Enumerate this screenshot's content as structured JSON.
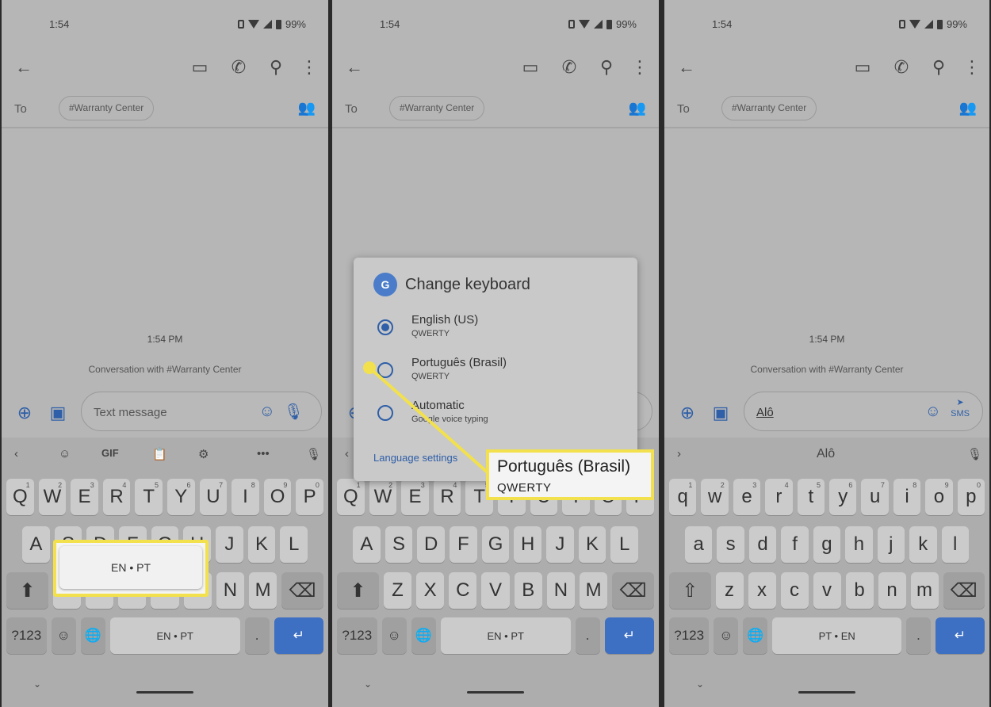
{
  "status": {
    "time": "1:54",
    "battery": "99%"
  },
  "toolbar": {
    "to_label": "To",
    "recipient": "#Warranty Center"
  },
  "conversation": {
    "time": "1:54 PM",
    "with_text": "Conversation with #Warranty Center"
  },
  "compose": {
    "placeholder": "Text message",
    "typed_text": "Alô",
    "send_label": "SMS"
  },
  "keyboard_tools": {
    "gif": "GIF",
    "more": "•••",
    "suggestion": "Alô"
  },
  "keys": {
    "row1_upper": [
      "Q",
      "W",
      "E",
      "R",
      "T",
      "Y",
      "U",
      "I",
      "O",
      "P"
    ],
    "row1_lower": [
      "q",
      "w",
      "e",
      "r",
      "t",
      "y",
      "u",
      "i",
      "o",
      "p"
    ],
    "row1_hints": [
      "1",
      "2",
      "3",
      "4",
      "5",
      "6",
      "7",
      "8",
      "9",
      "0"
    ],
    "row2_upper": [
      "A",
      "S",
      "D",
      "F",
      "G",
      "H",
      "J",
      "K",
      "L"
    ],
    "row2_lower": [
      "a",
      "s",
      "d",
      "f",
      "g",
      "h",
      "j",
      "k",
      "l"
    ],
    "row3_upper": [
      "Z",
      "X",
      "C",
      "V",
      "B",
      "N",
      "M"
    ],
    "row3_lower": [
      "z",
      "x",
      "c",
      "v",
      "b",
      "n",
      "m"
    ],
    "symbols": "?123",
    "space_en_pt": "EN • PT",
    "space_pt_en": "PT • EN",
    "period": "."
  },
  "popup_enpt": {
    "label": "EN • PT"
  },
  "dialog": {
    "title": "Change keyboard",
    "options": [
      {
        "name": "English (US)",
        "sub": "QWERTY",
        "selected": true
      },
      {
        "name": "Português (Brasil)",
        "sub": "QWERTY",
        "selected": false
      },
      {
        "name": "Automatic",
        "sub": "Google voice typing",
        "selected": false
      }
    ],
    "settings_link": "Language settings"
  },
  "callout": {
    "title": "Português (Brasil)",
    "sub": "QWERTY"
  },
  "colors": {
    "accent": "#2f5fa8",
    "highlight": "#f2e14c",
    "enter_key": "#3d6fc2"
  }
}
